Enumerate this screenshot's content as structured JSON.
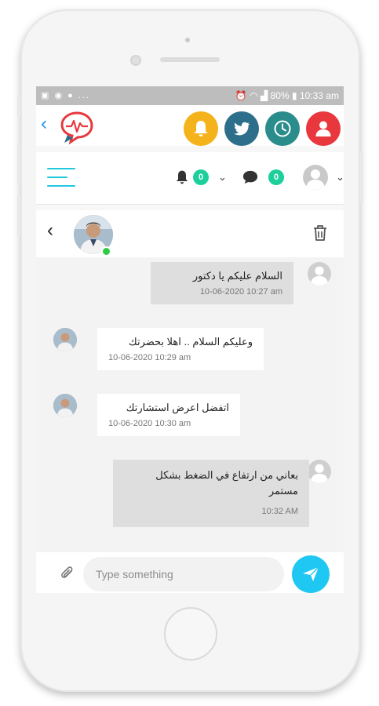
{
  "status_bar": {
    "left_icons": "▣ ◉ ● ...",
    "battery": "80%",
    "time": "10:33 am"
  },
  "app_bar": {
    "back_icon": "chevron-left-icon",
    "logo_icon": "chat-heartbeat-logo",
    "buttons": [
      {
        "name": "notifications",
        "icon": "bell-icon",
        "color": "#f5b31b"
      },
      {
        "name": "twitter",
        "icon": "bird-icon",
        "color": "#2d6f8a"
      },
      {
        "name": "clock",
        "icon": "clock-icon",
        "color": "#2b8c8c"
      },
      {
        "name": "profile",
        "icon": "person-icon",
        "color": "#e8383d"
      }
    ]
  },
  "nav": {
    "notification_count": "0",
    "message_count": "0",
    "accent": "#1ec9de",
    "badge_color": "#1ccf9b"
  },
  "chat_header": {
    "back_icon": "chevron-left-icon",
    "delete_icon": "trash-icon",
    "online_color": "#2ecc40"
  },
  "messages": [
    {
      "direction": "sent",
      "text": "السلام عليكم يا دكتور",
      "time": "10-06-2020 10:27 am"
    },
    {
      "direction": "received",
      "text": "وعليكم السلام .. اهلا بحضرتك",
      "time": "10-06-2020 10:29 am"
    },
    {
      "direction": "received",
      "text": "اتفضل اعرض استشارتك",
      "time": "10-06-2020 10:30 am"
    },
    {
      "direction": "sent",
      "text": "بعاني من ارتفاع في الضغط بشكل مستمر",
      "time": "10:32 AM"
    }
  ],
  "composer": {
    "placeholder": "Type something",
    "value": "",
    "send_color": "#1fc8f2"
  }
}
